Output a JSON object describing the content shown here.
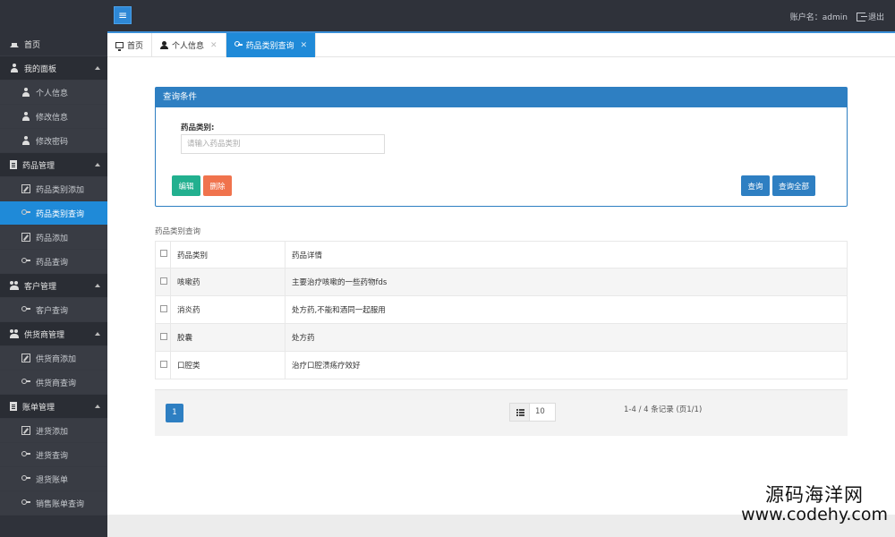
{
  "header": {
    "menu_toggle": "≡",
    "account_label": "账户名：admin",
    "logout_label": "退出"
  },
  "sidebar": {
    "items": [
      {
        "label": "首页",
        "icon": "home-icon",
        "type": "top"
      },
      {
        "label": "我的面板",
        "icon": "user-icon",
        "type": "group"
      },
      {
        "label": "个人信息",
        "icon": "user-icon",
        "type": "sub"
      },
      {
        "label": "修改信息",
        "icon": "user-icon",
        "type": "sub"
      },
      {
        "label": "修改密码",
        "icon": "user-icon",
        "type": "sub"
      },
      {
        "label": "药品管理",
        "icon": "file-icon",
        "type": "group"
      },
      {
        "label": "药品类别添加",
        "icon": "edit-icon",
        "type": "sub"
      },
      {
        "label": "药品类别查询",
        "icon": "keys-icon",
        "type": "sub",
        "active": true
      },
      {
        "label": "药品添加",
        "icon": "edit-icon",
        "type": "sub"
      },
      {
        "label": "药品查询",
        "icon": "keys-icon",
        "type": "sub"
      },
      {
        "label": "客户管理",
        "icon": "users-icon",
        "type": "group"
      },
      {
        "label": "客户查询",
        "icon": "keys-icon",
        "type": "sub"
      },
      {
        "label": "供货商管理",
        "icon": "users-icon",
        "type": "group"
      },
      {
        "label": "供货商添加",
        "icon": "edit-icon",
        "type": "sub"
      },
      {
        "label": "供货商查询",
        "icon": "keys-icon",
        "type": "sub"
      },
      {
        "label": "账单管理",
        "icon": "file-icon",
        "type": "group"
      },
      {
        "label": "进货添加",
        "icon": "edit-icon",
        "type": "sub"
      },
      {
        "label": "进货查询",
        "icon": "keys-icon",
        "type": "sub"
      },
      {
        "label": "退货账单",
        "icon": "keys-icon",
        "type": "sub"
      },
      {
        "label": "销售账单查询",
        "icon": "keys-icon",
        "type": "sub"
      }
    ]
  },
  "tabs": [
    {
      "label": "首页",
      "icon": "monitor-icon",
      "closable": false
    },
    {
      "label": "个人信息",
      "icon": "user-icon",
      "closable": true
    },
    {
      "label": "药品类别查询",
      "icon": "keys-icon",
      "closable": true,
      "active": true
    }
  ],
  "query_panel": {
    "title": "查询条件",
    "field_label": "药品类别:",
    "field_placeholder": "请输入药品类别",
    "field_value": "",
    "edit_label": "编辑",
    "delete_label": "删除",
    "query_label": "查询",
    "query_all_label": "查询全部"
  },
  "table": {
    "caption": "药品类别查询",
    "columns": [
      "药品类别",
      "药品详情"
    ],
    "rows": [
      {
        "category": "咳嗽药",
        "detail": "主要治疗咳嗽的一些药物fds"
      },
      {
        "category": "消炎药",
        "detail": "处方药,不能和酒同一起服用"
      },
      {
        "category": "胶囊",
        "detail": "处方药"
      },
      {
        "category": "口腔类",
        "detail": "治疗口腔溃疡疗效好"
      }
    ]
  },
  "pager": {
    "current_page": "1",
    "page_size": "10",
    "records_text": "1-4 / 4 条记录 (页1/1)"
  },
  "watermark": {
    "name": "源码海洋网",
    "url": "www.codehy.com"
  },
  "colors": {
    "sidebar_bg": "#2f323a",
    "accent": "#1f8ad8",
    "panel_blue": "#2e7fc2",
    "edit_green": "#22b08f",
    "delete_orange": "#f0734d"
  }
}
